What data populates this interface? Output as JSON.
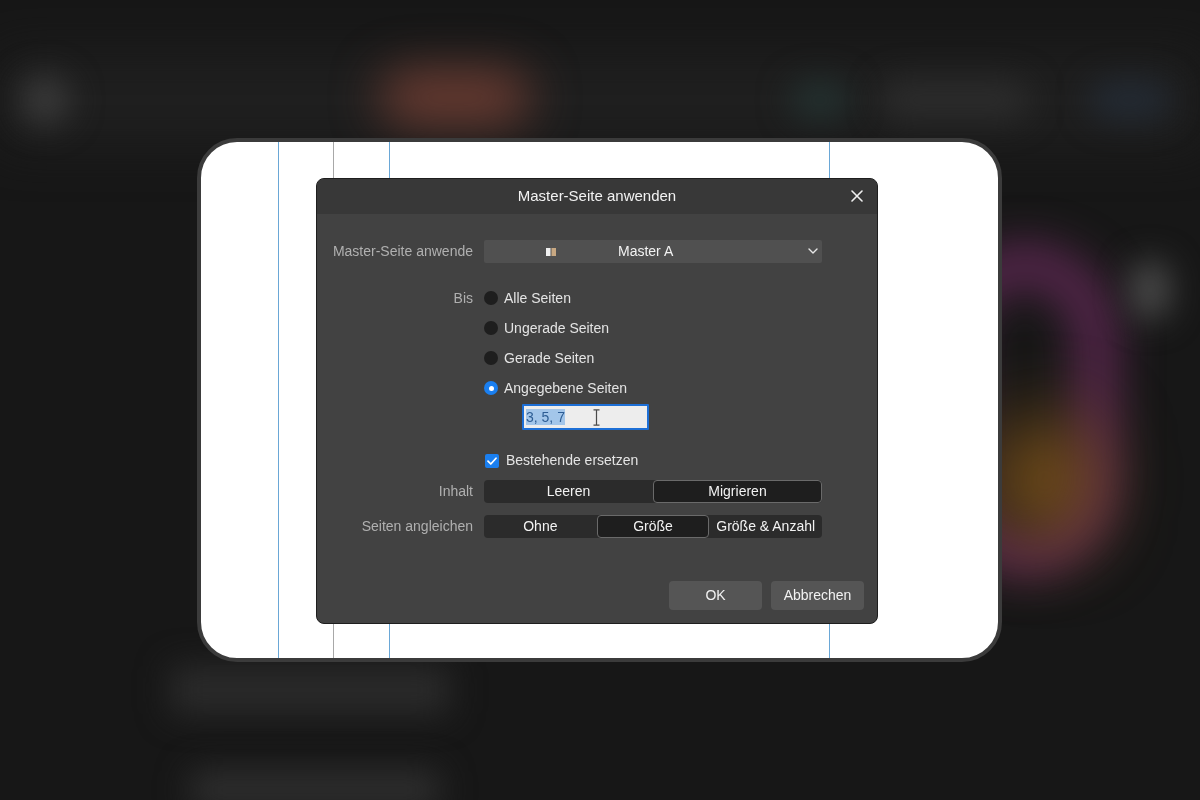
{
  "dialog": {
    "title": "Master-Seite anwenden"
  },
  "master_page": {
    "label": "Master-Seite anwende",
    "value": "Master A"
  },
  "apply_to": {
    "label": "Bis",
    "options": [
      {
        "label": "Alle Seiten",
        "selected": false
      },
      {
        "label": "Ungerade Seiten",
        "selected": false
      },
      {
        "label": "Gerade Seiten",
        "selected": false
      },
      {
        "label": "Angegebene Seiten",
        "selected": true
      }
    ],
    "pages_field": {
      "value": "3, 5, 7",
      "text_selected": true
    }
  },
  "replace_existing": {
    "label": "Bestehende ersetzen",
    "checked": true
  },
  "content": {
    "label": "Inhalt",
    "options": [
      {
        "label": "Leeren",
        "selected": false
      },
      {
        "label": "Migrieren",
        "selected": true
      }
    ]
  },
  "match_pages": {
    "label": "Seiten angleichen",
    "options": [
      {
        "label": "Ohne",
        "selected": false
      },
      {
        "label": "Größe",
        "selected": true
      },
      {
        "label": "Größe & Anzahl",
        "selected": false
      }
    ]
  },
  "buttons": [
    {
      "label": "OK"
    },
    {
      "label": "Abbrechen"
    }
  ]
}
